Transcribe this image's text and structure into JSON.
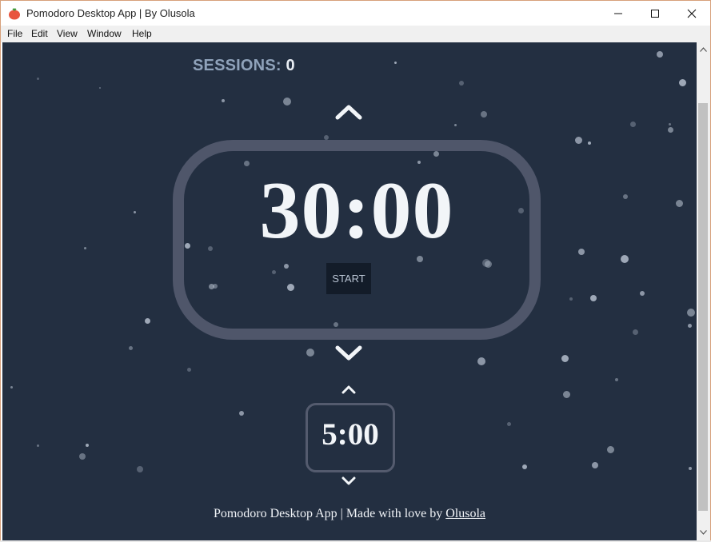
{
  "window": {
    "title": "Pomodoro Desktop App | By Olusola",
    "minimize_icon": "minimize-icon",
    "maximize_icon": "maximize-icon",
    "close_icon": "close-icon"
  },
  "menu": {
    "items": [
      "File",
      "Edit",
      "View",
      "Window",
      "Help"
    ]
  },
  "sessions": {
    "label": "SESSIONS:",
    "count": "0"
  },
  "timer": {
    "value": "30:00",
    "start_label": "START",
    "increase_icon": "chevron-up-icon",
    "decrease_icon": "chevron-down-icon"
  },
  "break_timer": {
    "value": "5:00",
    "increase_icon": "chevron-up-icon",
    "decrease_icon": "chevron-down-icon"
  },
  "footer": {
    "text": "Pomodoro Desktop App | Made with love by",
    "author_link": "Olusola"
  },
  "colors": {
    "background": "#232f41",
    "ring": "#4f566a",
    "sessions_label": "#8fa2ba",
    "text": "#f2f5f8"
  }
}
